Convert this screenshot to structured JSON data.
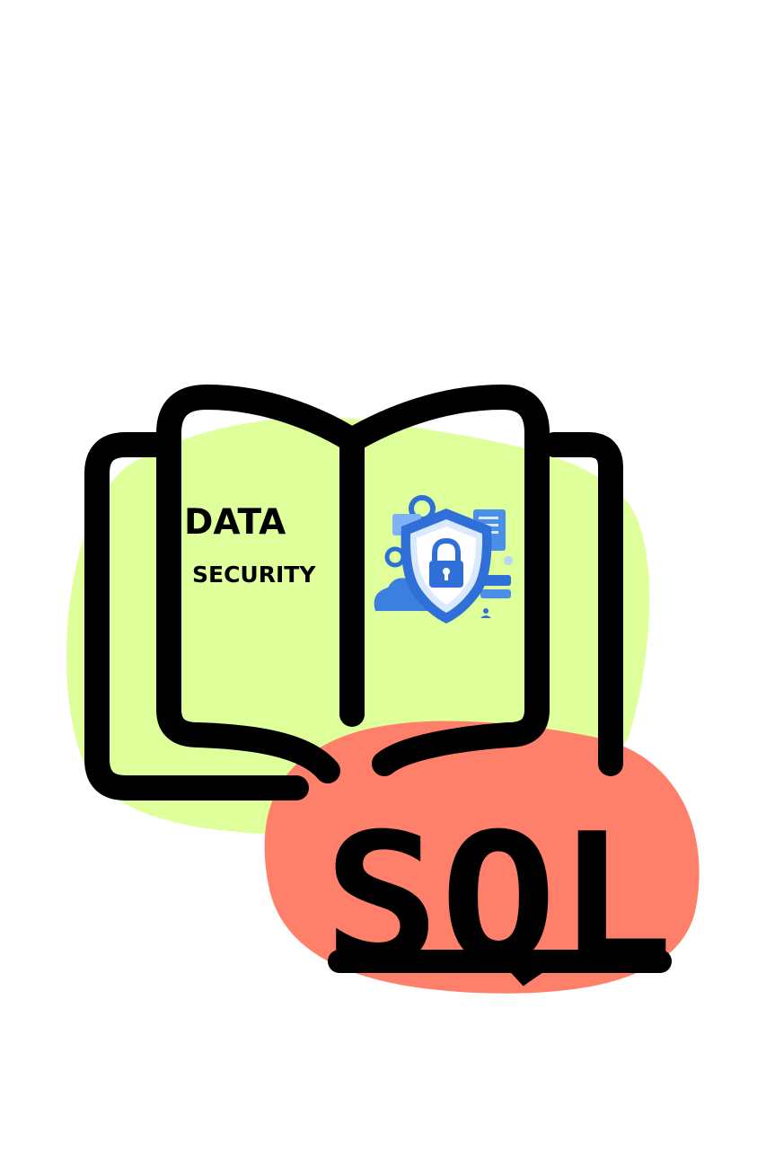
{
  "illustration": {
    "left_page": {
      "title_line1": "DATA",
      "title_line2": "SECURITY"
    },
    "right_page": {
      "icon": "shield-lock-icon"
    },
    "sql_label": "SQL"
  },
  "colors": {
    "background": "#ffffff",
    "green_blob": "#deff9a",
    "red_blob": "#fe806a",
    "outline": "#000000",
    "shield_blue": "#2f6fd8",
    "shield_light": "#dbe9ff"
  }
}
